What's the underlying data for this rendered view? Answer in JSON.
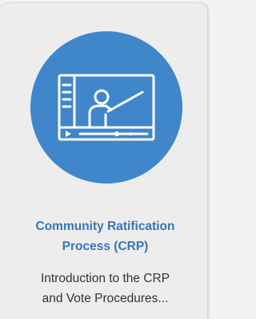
{
  "card": {
    "title_line1": "Community Ratification",
    "title_line2": "Process (CRP)",
    "description_line1": "Introduction to the CRP",
    "description_line2": "and Vote Procedures...",
    "icon": "video-presentation-icon"
  },
  "colors": {
    "accent": "#3f86cb",
    "title": "#3a74b8",
    "text": "#333333",
    "card_background": "#ededed"
  }
}
